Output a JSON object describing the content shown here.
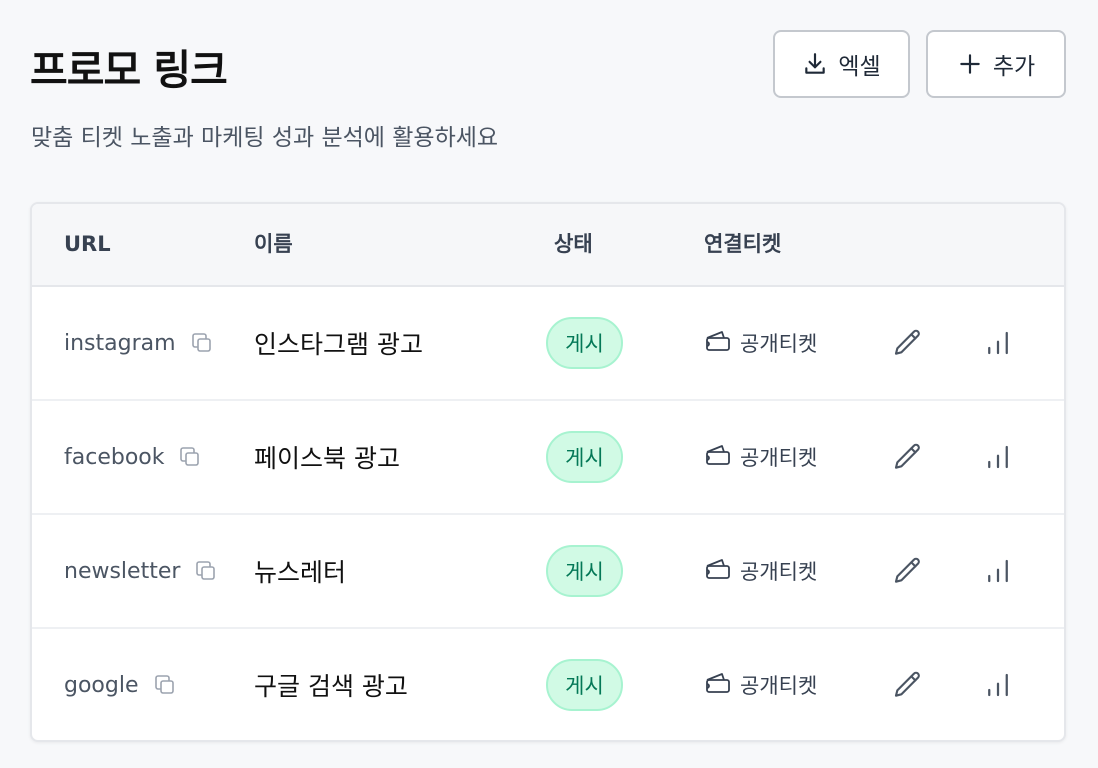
{
  "header": {
    "title": "프로모 링크",
    "subtitle": "맞춤 티켓 노출과 마케팅 성과 분석에 활용하세요",
    "excel_label": "엑셀",
    "add_label": "추가"
  },
  "table": {
    "columns": [
      "URL",
      "이름",
      "상태",
      "연결티켓"
    ],
    "rows": [
      {
        "url": "instagram",
        "name": "인스타그램 광고",
        "status": "게시",
        "ticket": "공개티켓"
      },
      {
        "url": "facebook",
        "name": "페이스북 광고",
        "status": "게시",
        "ticket": "공개티켓"
      },
      {
        "url": "newsletter",
        "name": "뉴스레터",
        "status": "게시",
        "ticket": "공개티켓"
      },
      {
        "url": "google",
        "name": "구글 검색 광고",
        "status": "게시",
        "ticket": "공개티켓"
      }
    ]
  },
  "icons": {
    "excel": "download-icon",
    "add": "plus-icon",
    "copy": "copy-icon",
    "ticket": "ticket-icon",
    "edit": "pencil-icon",
    "stats": "bar-chart-icon"
  },
  "colors": {
    "status_bg": "#d1fae5",
    "status_text": "#047857",
    "status_border": "#a7f3d0"
  }
}
